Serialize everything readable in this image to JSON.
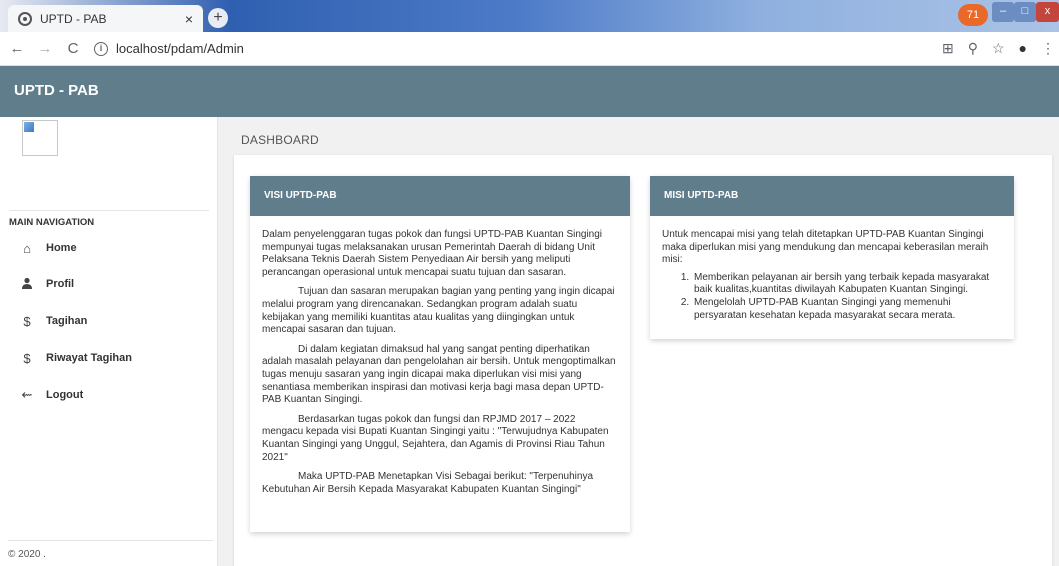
{
  "browser": {
    "tab_title": "UPTD - PAB",
    "tab_close": "×",
    "new_tab": "+",
    "badge": "71",
    "url": "localhost/pdam/Admin",
    "nav_back": "←",
    "nav_forward": "→",
    "nav_reload": "C",
    "info": "i",
    "min": "–",
    "max": "□",
    "close": "x"
  },
  "app": {
    "brand": "UPTD - PAB"
  },
  "sidebar": {
    "nav_header": "MAIN NAVIGATION",
    "items": [
      {
        "label": "Home",
        "icon": "home-icon",
        "glyph": "⌂"
      },
      {
        "label": "Profil",
        "icon": "user-icon",
        "glyph": "👤"
      },
      {
        "label": "Tagihan",
        "icon": "dollar-icon",
        "glyph": "$"
      },
      {
        "label": "Riwayat Tagihan",
        "icon": "dollar-icon",
        "glyph": "$"
      },
      {
        "label": "Logout",
        "icon": "back-arrow-icon",
        "glyph": "⇜"
      }
    ],
    "copyright": "© 2020 ."
  },
  "main": {
    "page_title": "DASHBOARD",
    "visi": {
      "title": "VISI UPTD-PAB",
      "paragraphs": [
        "Dalam penyelenggaran tugas pokok dan fungsi UPTD-PAB Kuantan Singingi mempunyai tugas melaksanakan urusan Pemerintah Daerah di bidang Unit Pelaksana Teknis Daerah Sistem Penyediaan Air bersih yang meliputi perancangan operasional untuk mencapai suatu tujuan dan sasaran.",
        "Tujuan dan sasaran merupakan bagian yang penting yang ingin dicapai melalui program yang direncanakan. Sedangkan program adalah suatu kebijakan yang memiliki kuantitas atau kualitas yang diingingkan untuk mencapai sasaran dan tujuan.",
        "Di dalam kegiatan dimaksud hal yang sangat penting diperhatikan adalah masalah pelayanan dan pengelolahan air bersih. Untuk mengoptimalkan tugas menuju sasaran yang ingin dicapai maka diperlukan visi misi yang senantiasa memberikan inspirasi dan motivasi kerja bagi masa depan UPTD-PAB Kuantan Singingi.",
        "Berdasarkan tugas pokok dan fungsi dan RPJMD 2017 – 2022 mengacu kepada visi Bupati Kuantan Singingi yaitu : \"Terwujudnya Kabupaten Kuantan Singingi yang Unggul, Sejahtera, dan Agamis di Provinsi Riau Tahun 2021\"",
        "Maka UPTD-PAB Menetapkan Visi Sebagai berikut: \"Terpenuhinya Kebutuhan Air Bersih Kepada Masyarakat Kabupaten Kuantan Singingi\""
      ]
    },
    "misi": {
      "title": "MISI UPTD-PAB",
      "intro": "Untuk mencapai misi yang telah ditetapkan UPTD-PAB Kuantan Singingi maka diperlukan misi yang mendukung dan mencapai keberasilan meraih misi:",
      "items": [
        "Memberikan pelayanan air bersih yang terbaik kepada masyarakat baik kualitas,kuantitas diwilayah Kabupaten Kuantan Singingi.",
        "Mengelolah UPTD-PAB Kuantan Singingi yang memenuhi persyaratan kesehatan kepada masyarakat secara merata."
      ]
    }
  }
}
